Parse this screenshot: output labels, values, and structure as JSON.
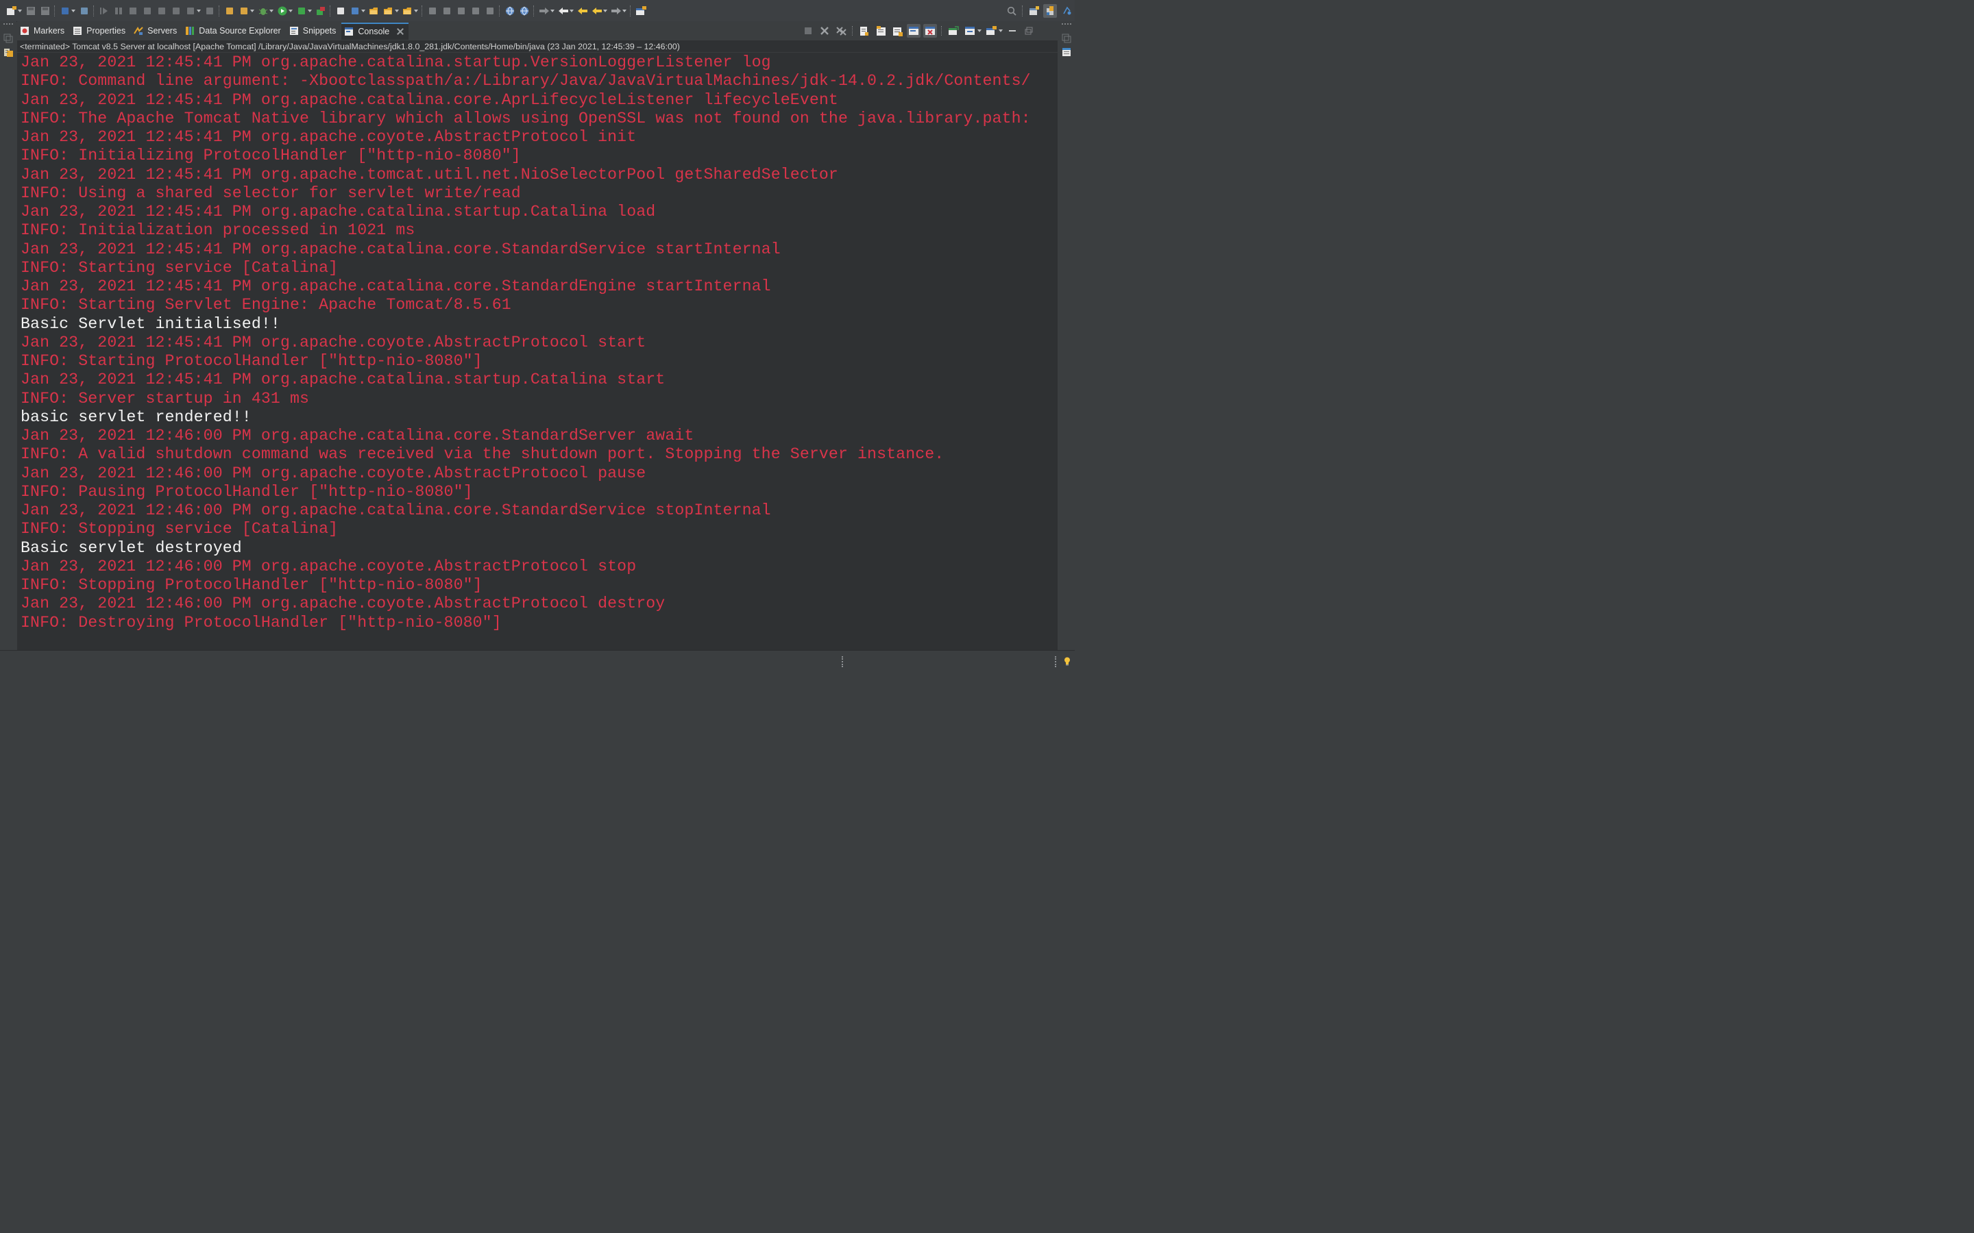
{
  "colors": {
    "stderr": "#d9344a",
    "stdout": "#f2f2f2",
    "console_bg": "#2f3133",
    "chrome_bg": "#3b3e40",
    "active_tab_accent": "#3f86c4"
  },
  "main_toolbar": {
    "icons": [
      "new-wizard-icon",
      "save-icon",
      "save-all-icon",
      "open-console-icon",
      "skip-breakpoints-icon",
      "resume-icon",
      "suspend-icon",
      "terminate-icon",
      "disconnect-icon",
      "step-into-icon",
      "step-over-icon",
      "step-return-icon",
      "drop-to-frame-icon",
      "use-step-filters-icon",
      "toggle-ant-icon",
      "debug-icon",
      "run-icon",
      "coverage-icon",
      "external-tools-icon",
      "new-java-package-icon",
      "new-java-class-icon",
      "open-type-icon",
      "open-task-icon",
      "search-icon",
      "toggle-annotation-icon",
      "mark-occurrences-icon",
      "block-selection-icon",
      "word-wrap-icon",
      "show-whitespace-icon",
      "open-web-browser-icon",
      "web-services-icon",
      "next-annotation-icon",
      "previous-annotation-icon",
      "last-edit-location-icon",
      "back-icon",
      "forward-icon",
      "pin-editor-icon"
    ],
    "right_icons": [
      "find-action-icon",
      "open-perspective-icon",
      "java-ee-perspective-icon",
      "debug-perspective-icon"
    ]
  },
  "tabs": [
    {
      "label": "Markers",
      "icon": "markers-icon",
      "active": false
    },
    {
      "label": "Properties",
      "icon": "properties-icon",
      "active": false
    },
    {
      "label": "Servers",
      "icon": "servers-icon",
      "active": false
    },
    {
      "label": "Data Source Explorer",
      "icon": "data-source-explorer-icon",
      "active": false
    },
    {
      "label": "Snippets",
      "icon": "snippets-icon",
      "active": false
    },
    {
      "label": "Console",
      "icon": "console-icon",
      "active": true
    }
  ],
  "view_toolbar": {
    "icons": [
      "terminate-icon",
      "remove-launch-icon",
      "remove-all-terminated-icon",
      "scroll-lock-icon",
      "word-wrap-icon",
      "show-console-on-stdout-icon",
      "show-console-on-stderr-icon",
      "pin-console-icon",
      "display-selected-console-icon",
      "open-console-icon",
      "minimize-icon",
      "maximize-icon"
    ]
  },
  "console": {
    "description": "<terminated> Tomcat v8.5 Server at localhost [Apache Tomcat] /Library/Java/JavaVirtualMachines/jdk1.8.0_281.jdk/Contents/Home/bin/java  (23 Jan 2021, 12:45:39 – 12:46:00)",
    "lines": [
      {
        "text": "Jan 23, 2021 12:45:41 PM org.apache.catalina.startup.VersionLoggerListener log",
        "stream": "err"
      },
      {
        "text": "INFO: Command line argument: -Xbootclasspath/a:/Library/Java/JavaVirtualMachines/jdk-14.0.2.jdk/Contents/",
        "stream": "err"
      },
      {
        "text": "Jan 23, 2021 12:45:41 PM org.apache.catalina.core.AprLifecycleListener lifecycleEvent",
        "stream": "err"
      },
      {
        "text": "INFO: The Apache Tomcat Native library which allows using OpenSSL was not found on the java.library.path:",
        "stream": "err"
      },
      {
        "text": "Jan 23, 2021 12:45:41 PM org.apache.coyote.AbstractProtocol init",
        "stream": "err"
      },
      {
        "text": "INFO: Initializing ProtocolHandler [\"http-nio-8080\"]",
        "stream": "err"
      },
      {
        "text": "Jan 23, 2021 12:45:41 PM org.apache.tomcat.util.net.NioSelectorPool getSharedSelector",
        "stream": "err"
      },
      {
        "text": "INFO: Using a shared selector for servlet write/read",
        "stream": "err"
      },
      {
        "text": "Jan 23, 2021 12:45:41 PM org.apache.catalina.startup.Catalina load",
        "stream": "err"
      },
      {
        "text": "INFO: Initialization processed in 1021 ms",
        "stream": "err"
      },
      {
        "text": "Jan 23, 2021 12:45:41 PM org.apache.catalina.core.StandardService startInternal",
        "stream": "err"
      },
      {
        "text": "INFO: Starting service [Catalina]",
        "stream": "err"
      },
      {
        "text": "Jan 23, 2021 12:45:41 PM org.apache.catalina.core.StandardEngine startInternal",
        "stream": "err"
      },
      {
        "text": "INFO: Starting Servlet Engine: Apache Tomcat/8.5.61",
        "stream": "err"
      },
      {
        "text": "Basic Servlet initialised!!",
        "stream": "out"
      },
      {
        "text": "Jan 23, 2021 12:45:41 PM org.apache.coyote.AbstractProtocol start",
        "stream": "err"
      },
      {
        "text": "INFO: Starting ProtocolHandler [\"http-nio-8080\"]",
        "stream": "err"
      },
      {
        "text": "Jan 23, 2021 12:45:41 PM org.apache.catalina.startup.Catalina start",
        "stream": "err"
      },
      {
        "text": "INFO: Server startup in 431 ms",
        "stream": "err"
      },
      {
        "text": "basic servlet rendered!!",
        "stream": "out"
      },
      {
        "text": "Jan 23, 2021 12:46:00 PM org.apache.catalina.core.StandardServer await",
        "stream": "err"
      },
      {
        "text": "INFO: A valid shutdown command was received via the shutdown port. Stopping the Server instance.",
        "stream": "err"
      },
      {
        "text": "Jan 23, 2021 12:46:00 PM org.apache.coyote.AbstractProtocol pause",
        "stream": "err"
      },
      {
        "text": "INFO: Pausing ProtocolHandler [\"http-nio-8080\"]",
        "stream": "err"
      },
      {
        "text": "Jan 23, 2021 12:46:00 PM org.apache.catalina.core.StandardService stopInternal",
        "stream": "err"
      },
      {
        "text": "INFO: Stopping service [Catalina]",
        "stream": "err"
      },
      {
        "text": "Basic servlet destroyed",
        "stream": "out"
      },
      {
        "text": "Jan 23, 2021 12:46:00 PM org.apache.coyote.AbstractProtocol stop",
        "stream": "err"
      },
      {
        "text": "INFO: Stopping ProtocolHandler [\"http-nio-8080\"]",
        "stream": "err"
      },
      {
        "text": "Jan 23, 2021 12:46:00 PM org.apache.coyote.AbstractProtocol destroy",
        "stream": "err"
      },
      {
        "text": "INFO: Destroying ProtocolHandler [\"http-nio-8080\"]",
        "stream": "err"
      }
    ]
  }
}
